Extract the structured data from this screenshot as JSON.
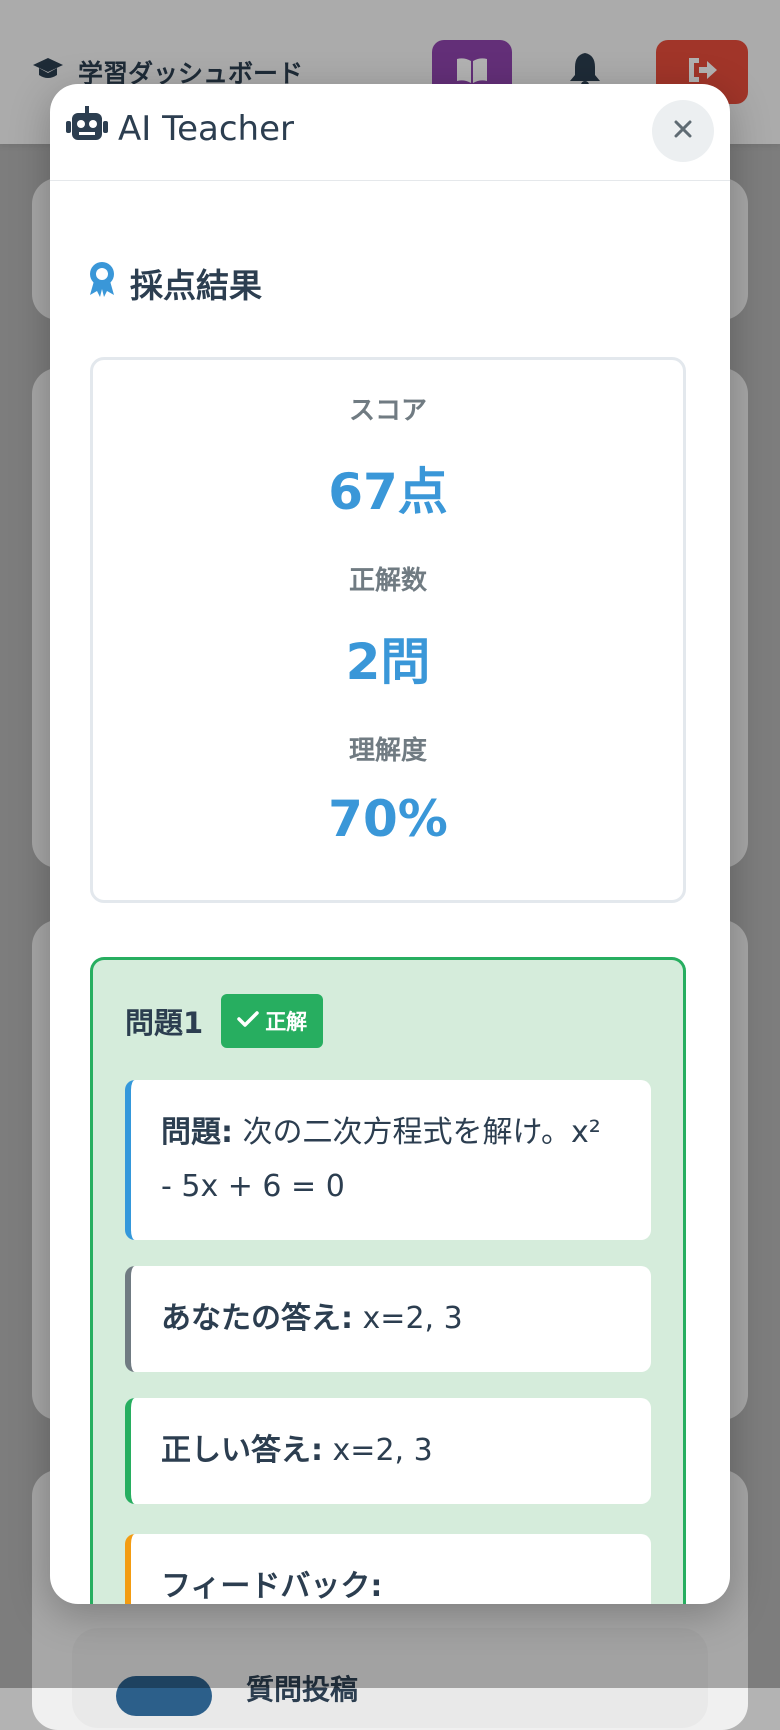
{
  "background": {
    "brand": "学習ダッシュボード",
    "section_partial": "質問投稿"
  },
  "modal": {
    "title": "AI Teacher",
    "section_title": "採点結果",
    "stats": {
      "score_label": "スコア",
      "score_value": "67点",
      "correct_label": "正解数",
      "correct_value": "2問",
      "understanding_label": "理解度",
      "understanding_value": "70%"
    },
    "question": {
      "title": "問題1",
      "status": "正解",
      "problem_label": "問題:",
      "problem_text": "次の二次方程式を解け。x² - 5x + 6 = 0",
      "your_answer_label": "あなたの答え:",
      "your_answer": "x=2, 3",
      "correct_answer_label": "正しい答え:",
      "correct_answer": "x=2, 3",
      "feedback_label": "フィードバック:"
    }
  },
  "colors": {
    "accent": "#3a97d8",
    "success": "#27ae60",
    "danger": "#e74c3c",
    "purple": "#8e44ad"
  }
}
